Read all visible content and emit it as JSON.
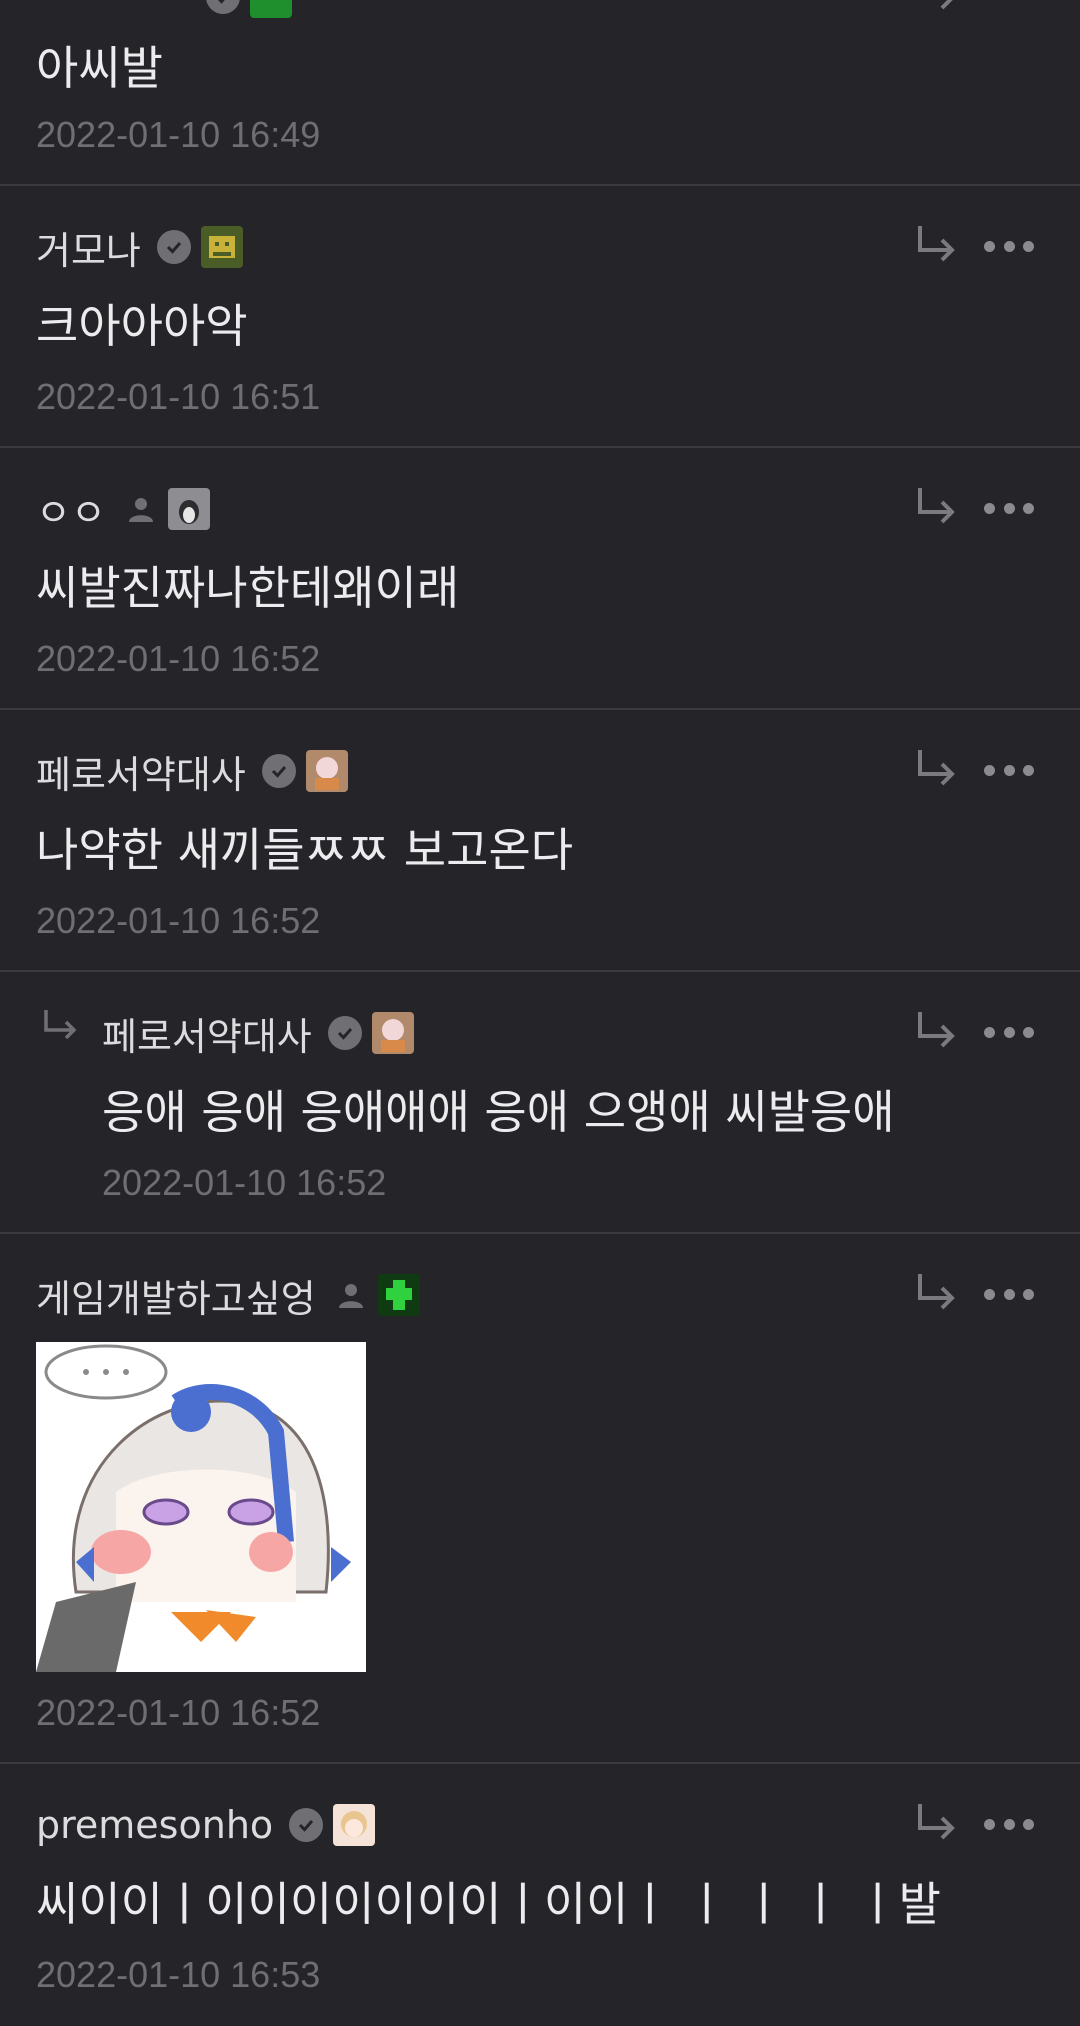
{
  "comments": [
    {
      "nickname": "",
      "text": "아씨발",
      "time": "2022-01-10 16:49",
      "badge": "verified",
      "level_color": "#1e8f2c"
    },
    {
      "nickname": "거모나",
      "text": "크아아아악",
      "time": "2022-01-10 16:51",
      "badge": "verified",
      "level_color": "#556b2f"
    },
    {
      "nickname": "ㅇㅇ",
      "text": "씨발진짜나한테왜이래",
      "time": "2022-01-10 16:52",
      "badge": "person",
      "level_color": "#9a9a9a"
    },
    {
      "nickname": "페로서약대사",
      "text": "나약한 새끼들ㅉㅉ 보고온다",
      "time": "2022-01-10 16:52",
      "badge": "verified",
      "level_color": "#b08a6a"
    },
    {
      "nickname": "페로서약대사",
      "text": "응애 응애 응애애애 응애 으앵애 씨발응애",
      "time": "2022-01-10 16:52",
      "badge": "verified",
      "level_color": "#b08a6a",
      "is_reply": true
    },
    {
      "nickname": "게임개발하고싶엉",
      "text": "",
      "time": "2022-01-10 16:52",
      "badge": "person",
      "level_color": "#1faa2e",
      "sticker": "anime-girl-sticker"
    },
    {
      "nickname": "premesonho",
      "text": "씨이이ㅣ이이이이이이이ㅣ이이ㅣ ㅣ ㅣ ㅣ ㅣ발",
      "time": "2022-01-10 16:53",
      "badge": "verified",
      "level_color": "#d9b08c"
    }
  ],
  "icons": {
    "reply": "reply-arrow-icon",
    "more": "more-dots-icon",
    "verified": "verified-check-icon",
    "person": "person-icon"
  },
  "colors": {
    "background": "#252529",
    "divider": "#3a3a3f",
    "timestamp": "#6e6e73"
  }
}
